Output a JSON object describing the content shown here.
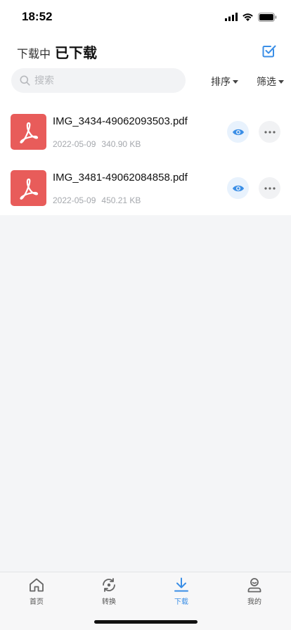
{
  "status_bar": {
    "time": "18:52"
  },
  "header": {
    "tab_downloading": "下载中",
    "tab_downloaded": "已下载"
  },
  "search": {
    "placeholder": "搜索"
  },
  "toolbar": {
    "sort_label": "排序",
    "filter_label": "筛选"
  },
  "colors": {
    "accent": "#3a8ee6",
    "pdf_red": "#e85c5a"
  },
  "files": [
    {
      "name": "IMG_3434-49062093503.pdf",
      "date": "2022-05-09",
      "size": "340.90 KB",
      "icon": "pdf-icon"
    },
    {
      "name": "IMG_3481-49062084858.pdf",
      "date": "2022-05-09",
      "size": "450.21 KB",
      "icon": "pdf-icon"
    }
  ],
  "tab_bar": {
    "items": [
      {
        "label": "首页",
        "icon": "home-icon"
      },
      {
        "label": "转换",
        "icon": "convert-icon"
      },
      {
        "label": "下载",
        "icon": "download-icon",
        "active": true
      },
      {
        "label": "我的",
        "icon": "profile-icon"
      }
    ]
  }
}
